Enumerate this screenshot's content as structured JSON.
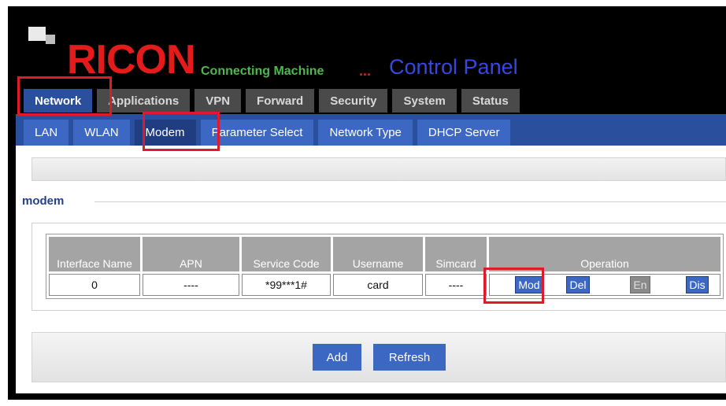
{
  "brand": {
    "name": "RICON",
    "tagline": "Connecting Machine",
    "dots": "...",
    "panel_title": "Control Panel"
  },
  "main_tabs": [
    {
      "label": "Network",
      "active": true
    },
    {
      "label": "Applications"
    },
    {
      "label": "VPN"
    },
    {
      "label": "Forward"
    },
    {
      "label": "Security"
    },
    {
      "label": "System"
    },
    {
      "label": "Status"
    }
  ],
  "sub_tabs": [
    {
      "label": "LAN"
    },
    {
      "label": "WLAN"
    },
    {
      "label": "Modem",
      "active": true
    },
    {
      "label": "Parameter Select"
    },
    {
      "label": "Network Type"
    },
    {
      "label": "DHCP Server"
    }
  ],
  "section": {
    "legend": "modem"
  },
  "table": {
    "headers": [
      "Interface Name",
      "APN",
      "Service Code",
      "Username",
      "Simcard",
      "Operation"
    ],
    "rows": [
      {
        "interface_name": "0",
        "apn": "----",
        "service_code": "*99***1#",
        "username": "card",
        "simcard": "----"
      }
    ],
    "operations": [
      "Mod",
      "Del",
      "En",
      "Dis"
    ]
  },
  "actions": {
    "add": "Add",
    "refresh": "Refresh"
  },
  "colors": {
    "active_tab": "#2a4f9c",
    "button": "#3c68c3",
    "brand_red": "#e31b1b",
    "highlight": "#e0192b"
  }
}
